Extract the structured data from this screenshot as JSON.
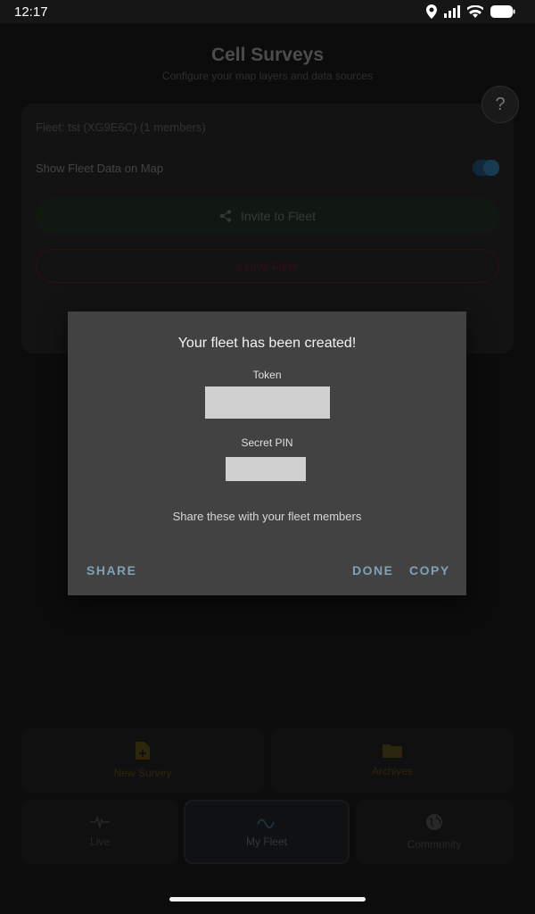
{
  "status": {
    "time": "12:17"
  },
  "header": {
    "title": "Cell Surveys",
    "subtitle": "Configure your map layers and data sources",
    "help_label": "?"
  },
  "fleet": {
    "info": "Fleet: tst (XG9E6C) (1 members)",
    "show_label": "Show Fleet Data on Map",
    "invite_label": "Invite to Fleet",
    "leave_label": "Leave Fleet"
  },
  "actions": {
    "new_survey": "New Survey",
    "archives": "Archives"
  },
  "tabs": {
    "live": "Live",
    "my_fleet": "My Fleet",
    "community": "Community"
  },
  "dialog": {
    "title": "Your fleet has been created!",
    "token_label": "Token",
    "token_value": "",
    "pin_label": "Secret PIN",
    "pin_value": "",
    "hint": "Share these with your fleet members",
    "share": "SHARE",
    "done": "DONE",
    "copy": "COPY"
  },
  "colors": {
    "accent": "#7fa1b8",
    "dialog_bg": "#424242",
    "leave_red": "#5a1e1e",
    "survey_yellow": "#4f4516"
  }
}
